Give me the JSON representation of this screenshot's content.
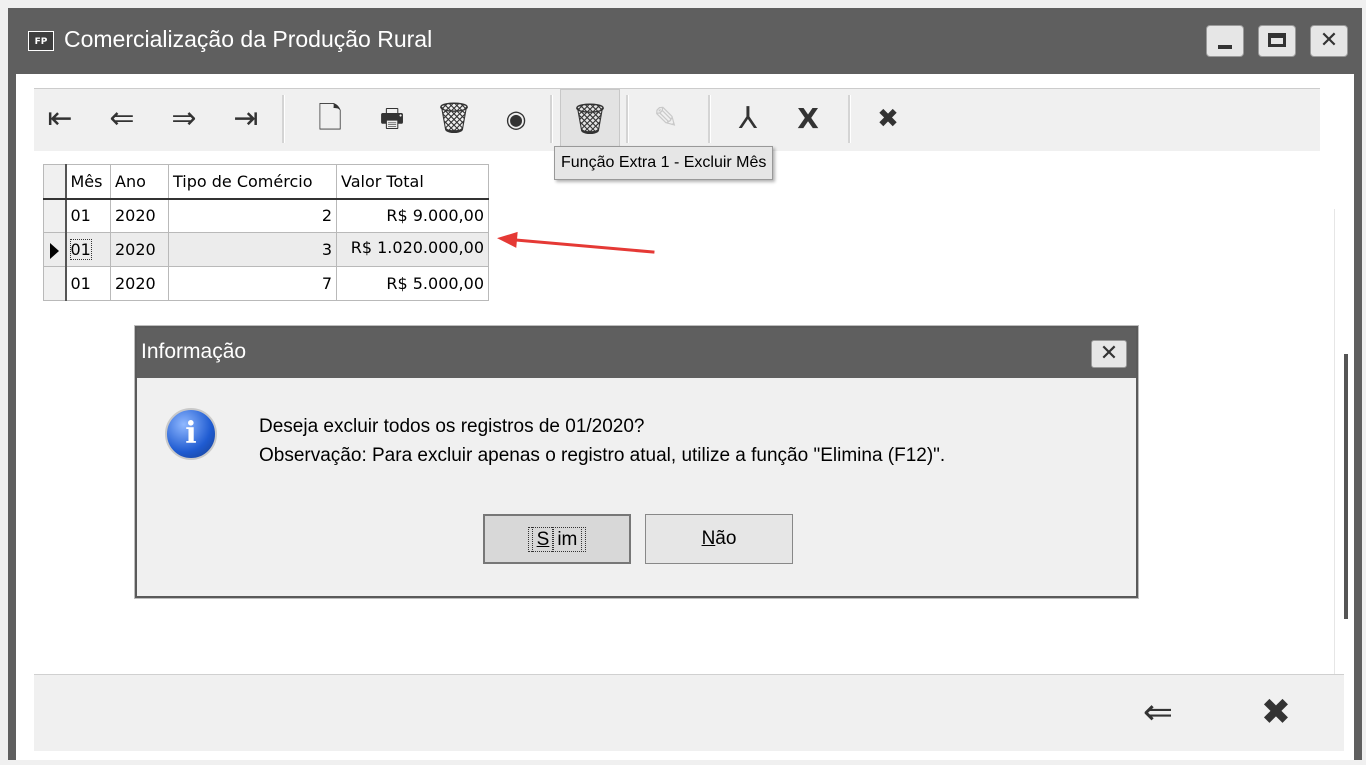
{
  "window": {
    "icon_text": "FP",
    "title": "Comercialização da Produção Rural",
    "controls": {
      "minimize": "minimize",
      "maximize": "maximize",
      "close": "✕"
    }
  },
  "toolbar": {
    "buttons": [
      {
        "name": "first-record",
        "glyph": "⇤"
      },
      {
        "name": "previous-record",
        "glyph": "⇐"
      },
      {
        "name": "next-record",
        "glyph": "⇒"
      },
      {
        "name": "last-record",
        "glyph": "⇥"
      },
      {
        "name": "new-document",
        "glyph": "🗋"
      },
      {
        "name": "print",
        "glyph": "🖶"
      },
      {
        "name": "delete",
        "glyph": "🗑"
      },
      {
        "name": "view",
        "glyph": "◉"
      },
      {
        "name": "extra-function-delete",
        "glyph": "🗑"
      },
      {
        "name": "edit-disabled",
        "glyph": "✎"
      },
      {
        "name": "pdf",
        "glyph": "⅄"
      },
      {
        "name": "excel",
        "glyph": "X"
      },
      {
        "name": "cancel",
        "glyph": "✖"
      }
    ]
  },
  "tooltip": {
    "text": "Função Extra 1 - Excluir Mês"
  },
  "grid": {
    "columns": [
      "Mês",
      "Ano",
      "Tipo de Comércio",
      "Valor Total"
    ],
    "rows": [
      {
        "mes": "01",
        "ano": "2020",
        "tipo": "2",
        "valor": "R$ 9.000,00"
      },
      {
        "mes": "01",
        "ano": "2020",
        "tipo": "3",
        "valor": "R$ 1.020.000,00"
      },
      {
        "mes": "01",
        "ano": "2020",
        "tipo": "7",
        "valor": "R$ 5.000,00"
      }
    ],
    "selected_row": 1
  },
  "dialog": {
    "title": "Informação",
    "close": "✕",
    "line1": "Deseja excluir todos os registros de 01/2020?",
    "line2": "Observação: Para excluir apenas o registro atual, utilize a função \"Elimina (F12)\".",
    "yes_prefix": "S",
    "yes_rest": "im",
    "no_prefix": "N",
    "no_rest": "ão"
  },
  "bottom": {
    "back_glyph": "⇐",
    "close_glyph": "✖"
  },
  "colors": {
    "titlebar": "#5f5f5f",
    "annotation_arrow": "#e53935"
  }
}
